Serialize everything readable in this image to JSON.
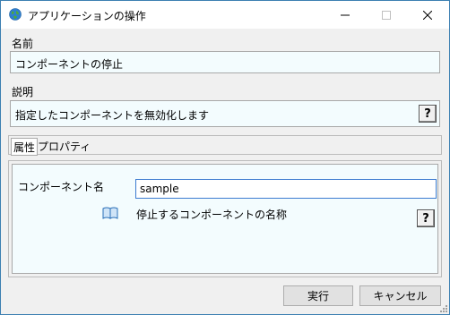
{
  "window": {
    "title": "アプリケーションの操作",
    "controls": {
      "minimize": "—",
      "maximize": "☐",
      "close": "✕"
    }
  },
  "name_group": {
    "label": "名前",
    "value": "コンポーネントの停止"
  },
  "description_group": {
    "label": "説明",
    "value": "指定したコンポーネントを無効化します",
    "help": "?"
  },
  "tabs": [
    {
      "label": "属性",
      "selected": true
    },
    {
      "label": "プロパティ",
      "selected": false
    }
  ],
  "property": {
    "label": "コンポーネント名",
    "value": "sample",
    "description": "停止するコンポーネントの名称",
    "help": "?"
  },
  "buttons": {
    "run": "実行",
    "cancel": "キャンセル"
  },
  "colors": {
    "field_bg": "#f3fcfe",
    "window_border": "#3c7fb1",
    "input_focus_border": "#3d7bd0"
  }
}
